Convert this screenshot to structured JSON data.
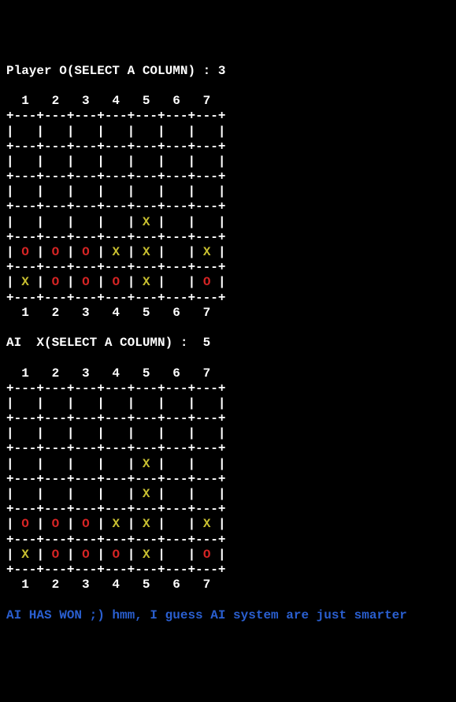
{
  "prompt1": "Player O(SELECT A COLUMN) : 3",
  "header": "  1   2   3   4   5   6   7",
  "divider": "+---+---+---+---+---+---+---+",
  "empty_row": "|   |   |   |   |   |   |   |",
  "prompt2": "AI  X(SELECT A COLUMN) :  5",
  "win_msg": "AI HAS WON ;) hmm, I guess AI system are just smarter",
  "X": "X",
  "O": "O",
  "pipe": "|",
  "sp": " ",
  "sp3": "   ",
  "board1": {
    "r4": [
      " ",
      " ",
      " ",
      " ",
      "X",
      " ",
      " "
    ],
    "r5": [
      "O",
      "O",
      "O",
      "X",
      "X",
      " ",
      "X"
    ],
    "r6": [
      "X",
      "O",
      "O",
      "O",
      "X",
      " ",
      "O"
    ]
  },
  "board2": {
    "r3": [
      " ",
      " ",
      " ",
      " ",
      "X",
      " ",
      " "
    ],
    "r4": [
      " ",
      " ",
      " ",
      " ",
      "X",
      " ",
      " "
    ],
    "r5": [
      "O",
      "O",
      "O",
      "X",
      "X",
      " ",
      "X"
    ],
    "r6": [
      "X",
      "O",
      "O",
      "O",
      "X",
      " ",
      "O"
    ]
  }
}
